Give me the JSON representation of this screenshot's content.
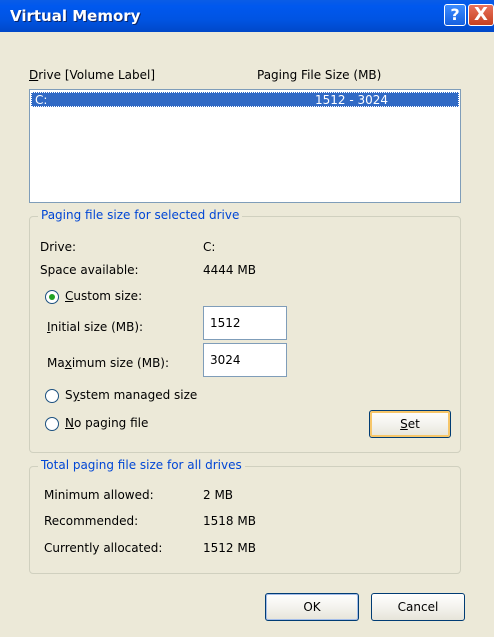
{
  "window": {
    "title": "Virtual Memory",
    "help_button": "?",
    "close_button": "X"
  },
  "list": {
    "header_drive": "Drive  [Volume Label]",
    "header_paging": "Paging File Size (MB)",
    "rows": [
      {
        "drive": "C:",
        "paging_size": "1512 - 3024",
        "selected": true
      }
    ]
  },
  "selected_drive": {
    "group_label": "Paging file size for selected drive",
    "drive_label": "Drive:",
    "drive_value": "C:",
    "space_label": "Space available:",
    "space_value": "4444 MB",
    "custom_size_label": "Custom size:",
    "initial_label": "Initial size (MB):",
    "initial_value": "1512",
    "maximum_label": "Maximum size (MB):",
    "maximum_value": "3024",
    "system_managed_label": "System managed size",
    "no_paging_label": "No paging file",
    "set_button": "Set",
    "selected_option": "custom"
  },
  "totals": {
    "group_label": "Total paging file size for all drives",
    "min_label": "Minimum allowed:",
    "min_value": "2 MB",
    "recommended_label": "Recommended:",
    "recommended_value": "1518 MB",
    "allocated_label": "Currently allocated:",
    "allocated_value": "1512 MB"
  },
  "footer": {
    "ok_button": "OK",
    "cancel_button": "Cancel"
  },
  "colors": {
    "titlebar": "#0054e3",
    "selection": "#316ac5",
    "group_label": "#0046d5",
    "dialog_bg": "#ece9d8"
  }
}
